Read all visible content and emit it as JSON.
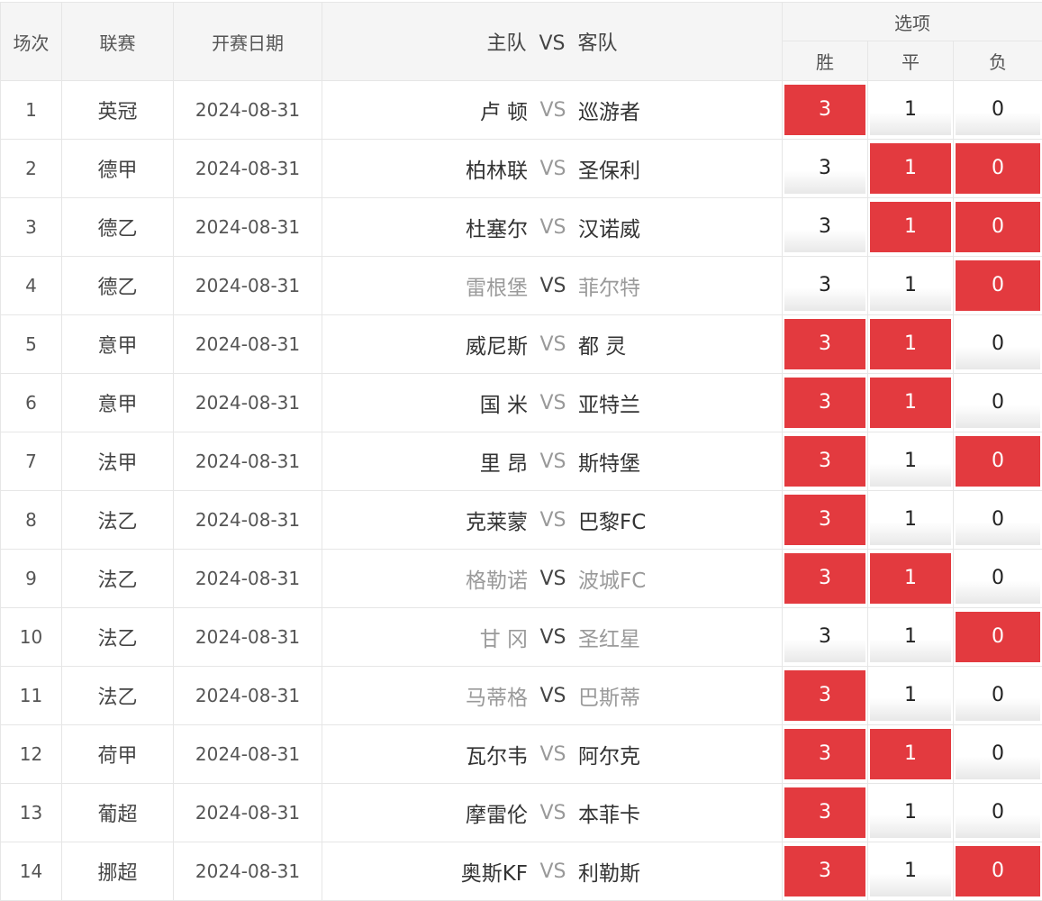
{
  "headers": {
    "index": "场次",
    "league": "联赛",
    "date": "开赛日期",
    "home": "主队",
    "vs": "VS",
    "away": "客队",
    "options": "选项",
    "win": "胜",
    "draw": "平",
    "loss": "负"
  },
  "colors": {
    "selected": "#e33a3f",
    "dim_team": "#9a9a9a",
    "vs": "#999999"
  },
  "matches": [
    {
      "no": "1",
      "league": "英冠",
      "date": "2024-08-31",
      "home": "卢 顿",
      "vs": "VS",
      "away": "巡游者",
      "dim": false,
      "opts": [
        {
          "label": "3",
          "selected": true
        },
        {
          "label": "1",
          "selected": false
        },
        {
          "label": "0",
          "selected": false
        }
      ]
    },
    {
      "no": "2",
      "league": "德甲",
      "date": "2024-08-31",
      "home": "柏林联",
      "vs": "VS",
      "away": "圣保利",
      "dim": false,
      "opts": [
        {
          "label": "3",
          "selected": false
        },
        {
          "label": "1",
          "selected": true
        },
        {
          "label": "0",
          "selected": true
        }
      ]
    },
    {
      "no": "3",
      "league": "德乙",
      "date": "2024-08-31",
      "home": "杜塞尔",
      "vs": "VS",
      "away": "汉诺威",
      "dim": false,
      "opts": [
        {
          "label": "3",
          "selected": false
        },
        {
          "label": "1",
          "selected": true
        },
        {
          "label": "0",
          "selected": true
        }
      ]
    },
    {
      "no": "4",
      "league": "德乙",
      "date": "2024-08-31",
      "home": "雷根堡",
      "vs": "VS",
      "away": "菲尔特",
      "dim": true,
      "opts": [
        {
          "label": "3",
          "selected": false
        },
        {
          "label": "1",
          "selected": false
        },
        {
          "label": "0",
          "selected": true
        }
      ]
    },
    {
      "no": "5",
      "league": "意甲",
      "date": "2024-08-31",
      "home": "威尼斯",
      "vs": "VS",
      "away": "都 灵",
      "dim": false,
      "opts": [
        {
          "label": "3",
          "selected": true
        },
        {
          "label": "1",
          "selected": true
        },
        {
          "label": "0",
          "selected": false
        }
      ]
    },
    {
      "no": "6",
      "league": "意甲",
      "date": "2024-08-31",
      "home": "国 米",
      "vs": "VS",
      "away": "亚特兰",
      "dim": false,
      "opts": [
        {
          "label": "3",
          "selected": true
        },
        {
          "label": "1",
          "selected": true
        },
        {
          "label": "0",
          "selected": false
        }
      ]
    },
    {
      "no": "7",
      "league": "法甲",
      "date": "2024-08-31",
      "home": "里 昂",
      "vs": "VS",
      "away": "斯特堡",
      "dim": false,
      "opts": [
        {
          "label": "3",
          "selected": true
        },
        {
          "label": "1",
          "selected": false
        },
        {
          "label": "0",
          "selected": true
        }
      ]
    },
    {
      "no": "8",
      "league": "法乙",
      "date": "2024-08-31",
      "home": "克莱蒙",
      "vs": "VS",
      "away": "巴黎FC",
      "dim": false,
      "opts": [
        {
          "label": "3",
          "selected": true
        },
        {
          "label": "1",
          "selected": false
        },
        {
          "label": "0",
          "selected": false
        }
      ]
    },
    {
      "no": "9",
      "league": "法乙",
      "date": "2024-08-31",
      "home": "格勒诺",
      "vs": "VS",
      "away": "波城FC",
      "dim": true,
      "opts": [
        {
          "label": "3",
          "selected": true
        },
        {
          "label": "1",
          "selected": true
        },
        {
          "label": "0",
          "selected": false
        }
      ]
    },
    {
      "no": "10",
      "league": "法乙",
      "date": "2024-08-31",
      "home": "甘 冈",
      "vs": "VS",
      "away": "圣红星",
      "dim": true,
      "opts": [
        {
          "label": "3",
          "selected": false
        },
        {
          "label": "1",
          "selected": false
        },
        {
          "label": "0",
          "selected": true
        }
      ]
    },
    {
      "no": "11",
      "league": "法乙",
      "date": "2024-08-31",
      "home": "马蒂格",
      "vs": "VS",
      "away": "巴斯蒂",
      "dim": true,
      "opts": [
        {
          "label": "3",
          "selected": true
        },
        {
          "label": "1",
          "selected": false
        },
        {
          "label": "0",
          "selected": false
        }
      ]
    },
    {
      "no": "12",
      "league": "荷甲",
      "date": "2024-08-31",
      "home": "瓦尔韦",
      "vs": "VS",
      "away": "阿尔克",
      "dim": false,
      "opts": [
        {
          "label": "3",
          "selected": true
        },
        {
          "label": "1",
          "selected": true
        },
        {
          "label": "0",
          "selected": false
        }
      ]
    },
    {
      "no": "13",
      "league": "葡超",
      "date": "2024-08-31",
      "home": "摩雷伦",
      "vs": "VS",
      "away": "本菲卡",
      "dim": false,
      "opts": [
        {
          "label": "3",
          "selected": true
        },
        {
          "label": "1",
          "selected": false
        },
        {
          "label": "0",
          "selected": false
        }
      ]
    },
    {
      "no": "14",
      "league": "挪超",
      "date": "2024-08-31",
      "home": "奥斯KF",
      "vs": "VS",
      "away": "利勒斯",
      "dim": false,
      "opts": [
        {
          "label": "3",
          "selected": true
        },
        {
          "label": "1",
          "selected": false
        },
        {
          "label": "0",
          "selected": true
        }
      ]
    }
  ]
}
